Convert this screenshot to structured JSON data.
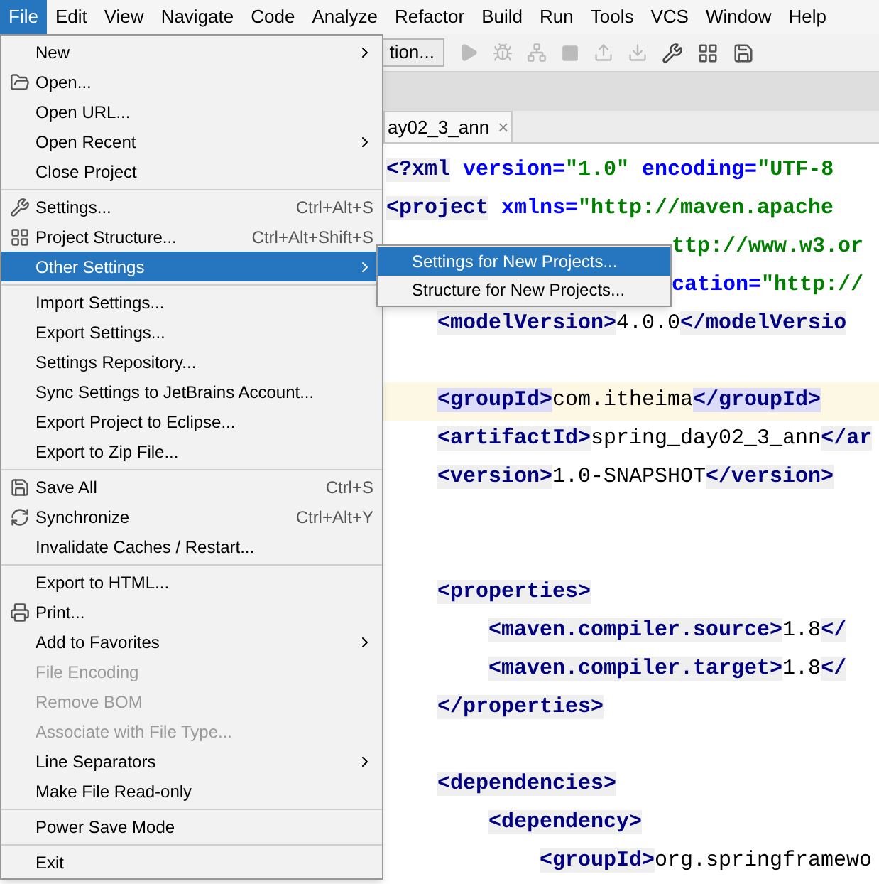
{
  "menu_bar": [
    {
      "label": "File",
      "selected": true
    },
    {
      "label": "Edit",
      "selected": false
    },
    {
      "label": "View",
      "selected": false
    },
    {
      "label": "Navigate",
      "selected": false
    },
    {
      "label": "Code",
      "selected": false
    },
    {
      "label": "Analyze",
      "selected": false
    },
    {
      "label": "Refactor",
      "selected": false
    },
    {
      "label": "Build",
      "selected": false
    },
    {
      "label": "Run",
      "selected": false
    },
    {
      "label": "Tools",
      "selected": false
    },
    {
      "label": "VCS",
      "selected": false
    },
    {
      "label": "Window",
      "selected": false
    },
    {
      "label": "Help",
      "selected": false
    }
  ],
  "toolbar": {
    "config_button": "tion..."
  },
  "editor_tab": {
    "label": "ay02_3_ann",
    "close": "×"
  },
  "editor_lines": [
    {
      "kind": "code",
      "segments": [
        {
          "kind": "tag",
          "text": "<?xml"
        },
        {
          "kind": "attr",
          "text": " version="
        },
        {
          "kind": "value",
          "text": "\"1.0\""
        },
        {
          "kind": "attr",
          "text": " encoding="
        },
        {
          "kind": "value",
          "text": "\"UTF-8"
        }
      ]
    },
    {
      "kind": "code",
      "segments": [
        {
          "kind": "tag",
          "text": "<project"
        },
        {
          "kind": "attr",
          "text": " xmlns="
        },
        {
          "kind": "value",
          "text": "\"http://maven.apache"
        }
      ],
      "children": [
        {
          "kind": "wrapped",
          "segments": [
            {
              "kind": "value",
              "text": "ttp://www.w3.or"
            }
          ]
        },
        {
          "kind": "wrapped",
          "segments": [
            {
              "kind": "attr",
              "text": "cation="
            },
            {
              "kind": "value",
              "text": "\"http://"
            }
          ]
        },
        {
          "kind": "code",
          "segments": [
            {
              "kind": "tag",
              "text": "<modelVersion>"
            },
            {
              "kind": "text",
              "text": "4.0.0"
            },
            {
              "kind": "tag",
              "text": "</modelVersio"
            }
          ]
        },
        {
          "kind": "blank"
        },
        {
          "kind": "code",
          "current": true,
          "segments": [
            {
              "kind": "match",
              "text": "<groupId>"
            },
            {
              "kind": "text",
              "text": "com.itheima"
            },
            {
              "kind": "match",
              "text": "</groupId>"
            }
          ]
        },
        {
          "kind": "code",
          "segments": [
            {
              "kind": "tag",
              "text": "<artifactId>"
            },
            {
              "kind": "text",
              "text": "spring_day02_3_ann"
            },
            {
              "kind": "tag",
              "text": "</ar"
            }
          ]
        },
        {
          "kind": "code",
          "segments": [
            {
              "kind": "tag",
              "text": "<version>"
            },
            {
              "kind": "text",
              "text": "1.0-SNAPSHOT"
            },
            {
              "kind": "tag",
              "text": "</version>"
            }
          ]
        },
        {
          "kind": "blank"
        },
        {
          "kind": "blank"
        },
        {
          "kind": "code",
          "segments": [
            {
              "kind": "tag",
              "text": "<properties>"
            }
          ],
          "children": [
            {
              "kind": "code",
              "segments": [
                {
                  "kind": "tag",
                  "text": "<maven.compiler.source>"
                },
                {
                  "kind": "text",
                  "text": "1.8"
                },
                {
                  "kind": "tag",
                  "text": "</"
                }
              ]
            },
            {
              "kind": "code",
              "segments": [
                {
                  "kind": "tag",
                  "text": "<maven.compiler.target>"
                },
                {
                  "kind": "text",
                  "text": "1.8"
                },
                {
                  "kind": "tag",
                  "text": "</"
                }
              ]
            }
          ]
        },
        {
          "kind": "code",
          "segments": [
            {
              "kind": "tag",
              "text": "</properties>"
            }
          ]
        },
        {
          "kind": "blank"
        },
        {
          "kind": "code",
          "segments": [
            {
              "kind": "tag",
              "text": "<dependencies>"
            }
          ],
          "children": [
            {
              "kind": "code",
              "segments": [
                {
                  "kind": "tag",
                  "text": "<dependency>"
                }
              ],
              "children": [
                {
                  "kind": "code",
                  "segments": [
                    {
                      "kind": "tag",
                      "text": "<groupId>"
                    },
                    {
                      "kind": "text",
                      "text": "org.springframewo"
                    }
                  ]
                }
              ]
            }
          ]
        }
      ]
    }
  ],
  "file_menu": [
    {
      "kind": "item",
      "label": "New",
      "submenu": true,
      "disabled": false,
      "selected": false
    },
    {
      "kind": "item",
      "label": "Open...",
      "submenu": false,
      "disabled": false,
      "selected": false
    },
    {
      "kind": "item",
      "label": "Open URL...",
      "submenu": false,
      "disabled": false,
      "selected": false
    },
    {
      "kind": "item",
      "label": "Open Recent",
      "submenu": true,
      "disabled": false,
      "selected": false
    },
    {
      "kind": "item",
      "label": "Close Project",
      "submenu": false,
      "disabled": false,
      "selected": false
    },
    {
      "kind": "separator"
    },
    {
      "kind": "item",
      "label": "Settings...",
      "shortcut": "Ctrl+Alt+S",
      "submenu": false,
      "disabled": false,
      "selected": false
    },
    {
      "kind": "item",
      "label": "Project Structure...",
      "shortcut": "Ctrl+Alt+Shift+S",
      "submenu": false,
      "disabled": false,
      "selected": false
    },
    {
      "kind": "item",
      "label": "Other Settings",
      "submenu": true,
      "disabled": false,
      "selected": true
    },
    {
      "kind": "separator"
    },
    {
      "kind": "item",
      "label": "Import Settings...",
      "submenu": false,
      "disabled": false,
      "selected": false
    },
    {
      "kind": "item",
      "label": "Export Settings...",
      "submenu": false,
      "disabled": false,
      "selected": false
    },
    {
      "kind": "item",
      "label": "Settings Repository...",
      "submenu": false,
      "disabled": false,
      "selected": false
    },
    {
      "kind": "item",
      "label": "Sync Settings to JetBrains Account...",
      "submenu": false,
      "disabled": false,
      "selected": false
    },
    {
      "kind": "item",
      "label": "Export Project to Eclipse...",
      "submenu": false,
      "disabled": false,
      "selected": false
    },
    {
      "kind": "item",
      "label": "Export to Zip File...",
      "submenu": false,
      "disabled": false,
      "selected": false
    },
    {
      "kind": "separator"
    },
    {
      "kind": "item",
      "label": "Save All",
      "shortcut": "Ctrl+S",
      "submenu": false,
      "disabled": false,
      "selected": false
    },
    {
      "kind": "item",
      "label": "Synchronize",
      "shortcut": "Ctrl+Alt+Y",
      "submenu": false,
      "disabled": false,
      "selected": false
    },
    {
      "kind": "item",
      "label": "Invalidate Caches / Restart...",
      "submenu": false,
      "disabled": false,
      "selected": false
    },
    {
      "kind": "separator"
    },
    {
      "kind": "item",
      "label": "Export to HTML...",
      "submenu": false,
      "disabled": false,
      "selected": false
    },
    {
      "kind": "item",
      "label": "Print...",
      "submenu": false,
      "disabled": false,
      "selected": false
    },
    {
      "kind": "item",
      "label": "Add to Favorites",
      "submenu": true,
      "disabled": false,
      "selected": false
    },
    {
      "kind": "item",
      "label": "File Encoding",
      "submenu": false,
      "disabled": true,
      "selected": false
    },
    {
      "kind": "item",
      "label": "Remove BOM",
      "submenu": false,
      "disabled": true,
      "selected": false
    },
    {
      "kind": "item",
      "label": "Associate with File Type...",
      "submenu": false,
      "disabled": true,
      "selected": false
    },
    {
      "kind": "item",
      "label": "Line Separators",
      "submenu": true,
      "disabled": false,
      "selected": false
    },
    {
      "kind": "item",
      "label": "Make File Read-only",
      "submenu": false,
      "disabled": false,
      "selected": false
    },
    {
      "kind": "separator"
    },
    {
      "kind": "item",
      "label": "Power Save Mode",
      "submenu": false,
      "disabled": false,
      "selected": false
    },
    {
      "kind": "separator"
    },
    {
      "kind": "item",
      "label": "Exit",
      "submenu": false,
      "disabled": false,
      "selected": false
    }
  ],
  "other_settings_submenu": [
    {
      "label": "Settings for New Projects...",
      "selected": true
    },
    {
      "label": "Structure for New Projects...",
      "selected": false
    }
  ]
}
